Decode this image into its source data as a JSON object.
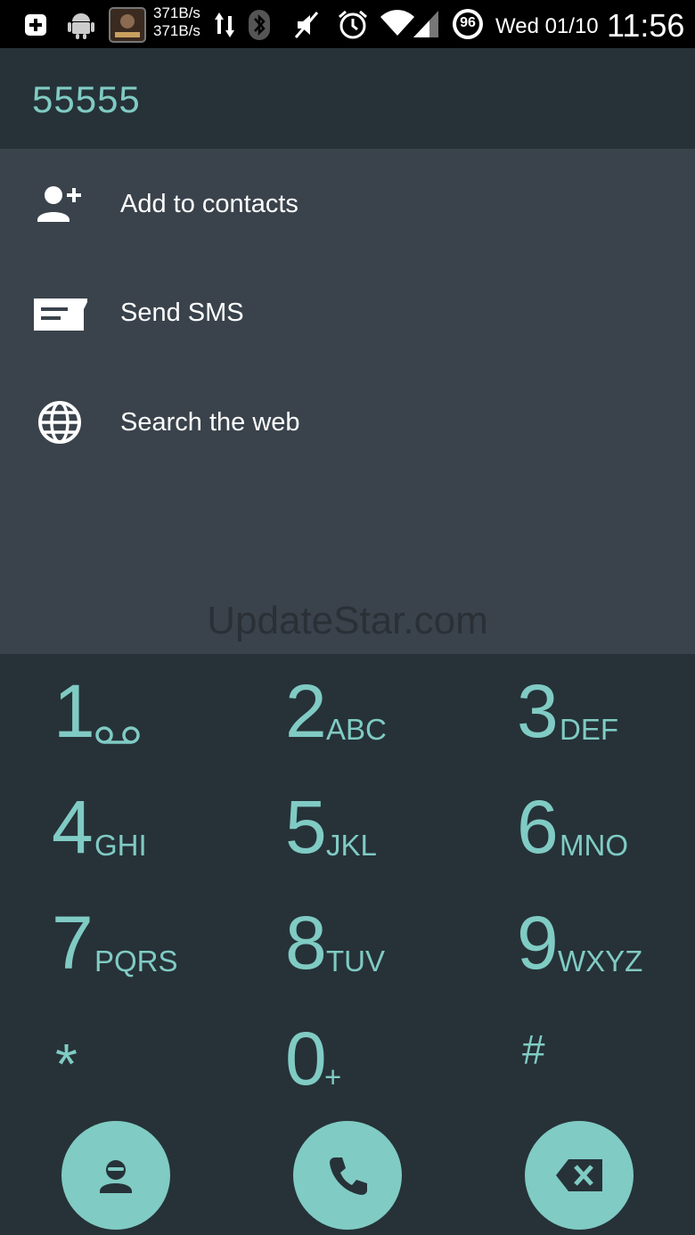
{
  "status_bar": {
    "speed_up": "371B/s",
    "speed_down": "371B/s",
    "battery": "96",
    "date": "Wed 01/10",
    "time": "11:56",
    "icons": [
      "add-box-icon",
      "android-icon",
      "manga-app-icon",
      "data-transfer-icon",
      "bluetooth-icon",
      "mute-icon",
      "alarm-icon",
      "wifi-icon",
      "signal-icon",
      "battery-icon"
    ]
  },
  "dialer": {
    "number": "55555"
  },
  "menu": {
    "items": [
      {
        "label": "Add to contacts",
        "icon": "add-contact-icon"
      },
      {
        "label": "Send SMS",
        "icon": "sms-icon"
      },
      {
        "label": "Search the web",
        "icon": "globe-icon"
      }
    ]
  },
  "watermark": "UpdateStar.com",
  "keypad": {
    "keys": [
      {
        "digit": "1",
        "letters": ""
      },
      {
        "digit": "2",
        "letters": "ABC"
      },
      {
        "digit": "3",
        "letters": "DEF"
      },
      {
        "digit": "4",
        "letters": "GHI"
      },
      {
        "digit": "5",
        "letters": "JKL"
      },
      {
        "digit": "6",
        "letters": "MNO"
      },
      {
        "digit": "7",
        "letters": "PQRS"
      },
      {
        "digit": "8",
        "letters": "TUV"
      },
      {
        "digit": "9",
        "letters": "WXYZ"
      },
      {
        "digit": "*",
        "letters": ""
      },
      {
        "digit": "0",
        "letters": "+"
      },
      {
        "digit": "#",
        "letters": ""
      }
    ]
  },
  "actions": {
    "icons": [
      "contacts-icon",
      "call-icon",
      "backspace-icon"
    ]
  },
  "colors": {
    "accent": "#80CBC4",
    "background": "#263238",
    "menu_background": "#3A434C"
  }
}
